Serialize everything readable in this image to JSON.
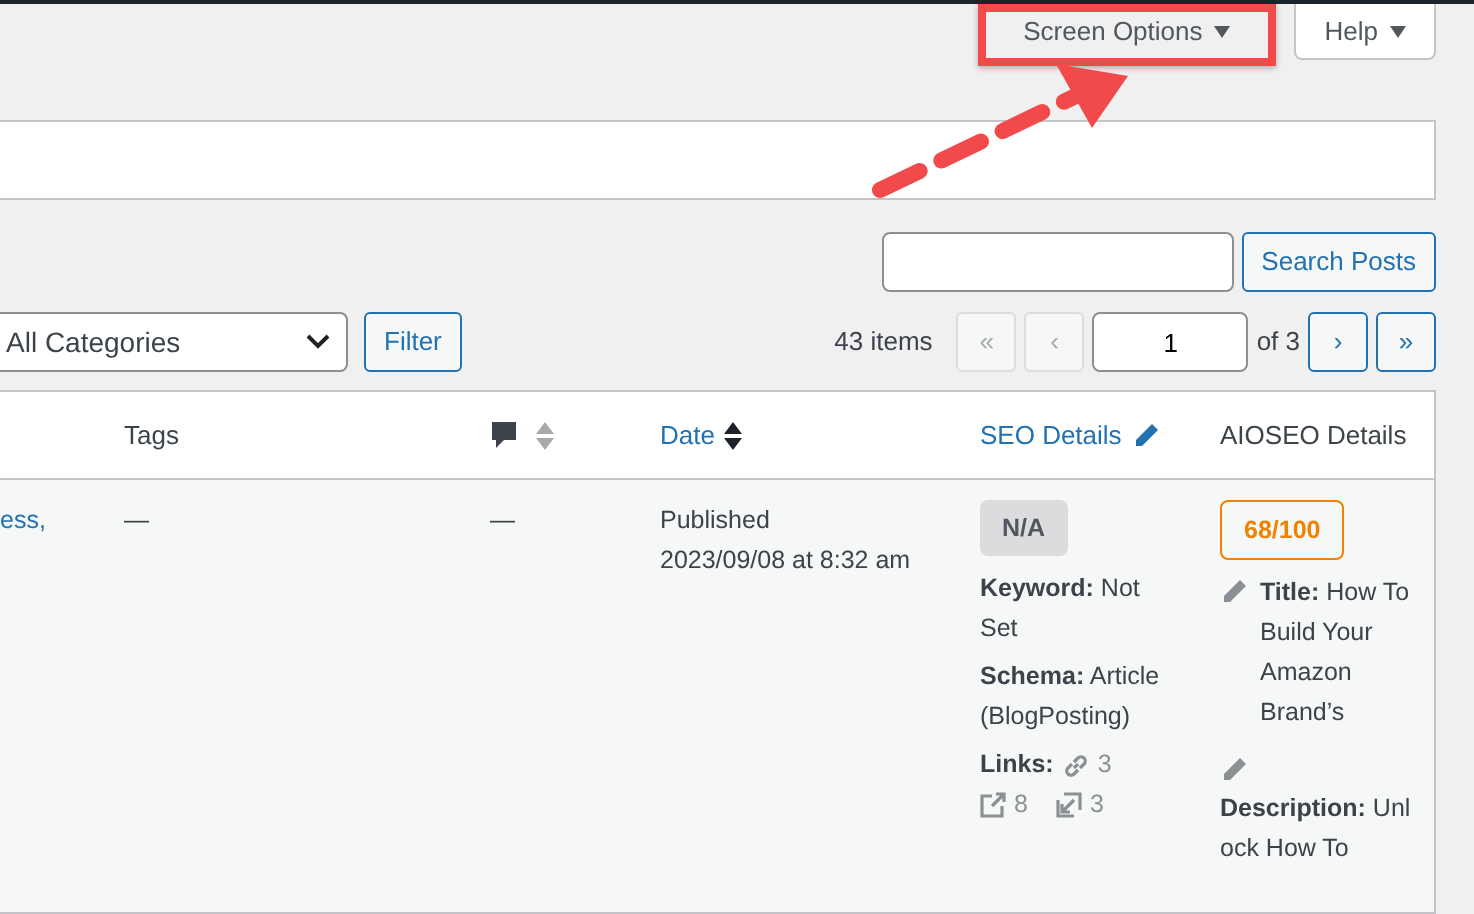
{
  "header_buttons": [
    {
      "label": "Screen Options",
      "highlighted": true
    },
    {
      "label": "Help",
      "highlighted": false
    }
  ],
  "search": {
    "button": "Search Posts"
  },
  "filter": {
    "category": "All Categories",
    "button": "Filter"
  },
  "pagination": {
    "count": "43 items",
    "before": [
      {
        "label": "«",
        "disabled": true
      },
      {
        "label": "‹",
        "disabled": true
      }
    ],
    "page": "1",
    "of": "of 3",
    "after": [
      {
        "label": "›",
        "disabled": false
      },
      {
        "label": "»",
        "disabled": false
      }
    ]
  },
  "table": {
    "columns": [
      {
        "kind": "blank"
      },
      {
        "kind": "text",
        "label": "Tags"
      },
      {
        "kind": "comments"
      },
      {
        "kind": "sortable",
        "label": "Date"
      },
      {
        "kind": "editable",
        "label": "SEO Details"
      },
      {
        "kind": "text",
        "label": "AIOSEO Details"
      }
    ],
    "rows": [
      {
        "column_1": "ess,",
        "tags": "—",
        "comments": "—",
        "date_status": "Published",
        "date_time": "2023/09/08 at 8:32 am",
        "seo": {
          "score": "N/A",
          "keyword": "**Keyword:** Not Set",
          "schema": "**Schema:** Article (BlogPosting)",
          "links_label": "Links:",
          "internal": "3",
          "external": "8",
          "inbound": "3"
        },
        "aioseo": {
          "score": "68/100",
          "title": "**Title:** How To Build Your Amazon Brand’s",
          "description": "**Description:** Unlock How To"
        }
      }
    ]
  }
}
